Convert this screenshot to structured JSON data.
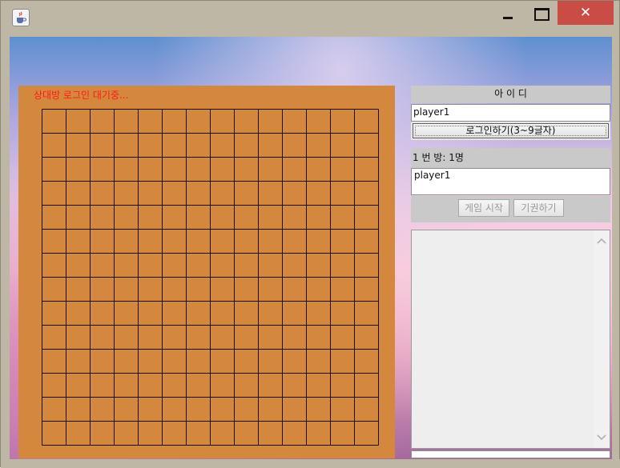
{
  "window": {
    "close_glyph": "✕",
    "icon": "java-cup-icon"
  },
  "board": {
    "status": "상대방 로그인 대기중...",
    "rows": 14,
    "cols": 14,
    "line_color": "#1a0f05",
    "board_color": "#d4883d"
  },
  "sidebar": {
    "id_header": "아 이 디",
    "id_value": "player1",
    "login_button": "로그인하기(3~9글자)",
    "room_label": "1 번 방: 1명",
    "users": [
      "player1"
    ],
    "start_button": "게임 시작",
    "resign_button": "기권하기"
  },
  "colors": {
    "status_text": "#ff1a1a",
    "close_button": "#c94c45"
  }
}
